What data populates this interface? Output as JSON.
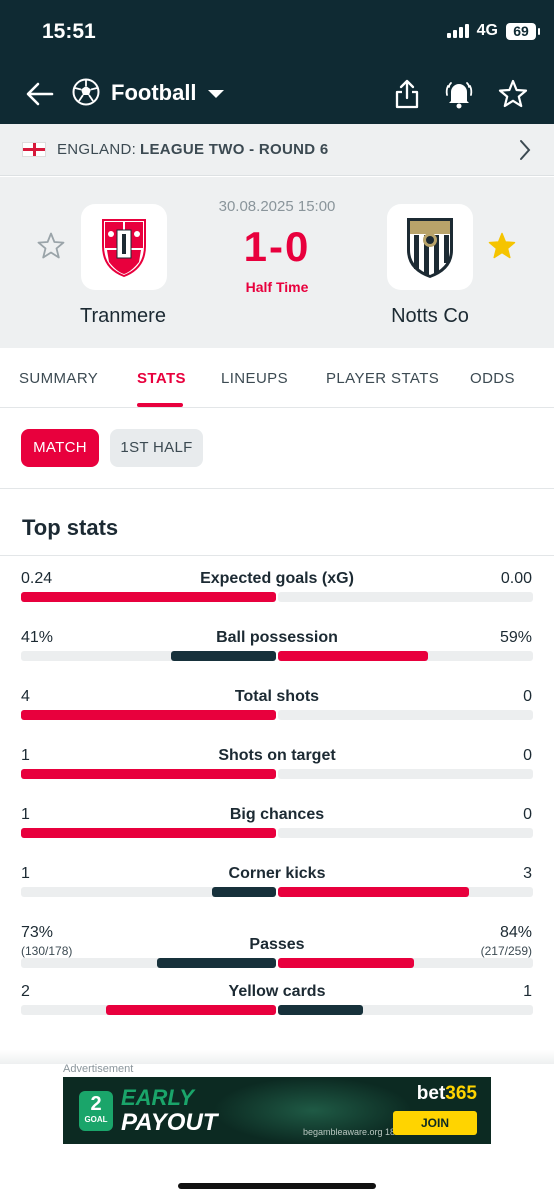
{
  "status_bar": {
    "time": "15:51",
    "network": "4G",
    "battery": "69"
  },
  "nav": {
    "title": "Football"
  },
  "league": {
    "country": "ENGLAND:",
    "name": "LEAGUE TWO - ROUND 6"
  },
  "match": {
    "kickoff": "30.08.2025 15:00",
    "score": "1-0",
    "period": "Half Time",
    "home": {
      "name": "Tranmere",
      "favorite": false,
      "crest_colors": [
        "#e8003d",
        "#1c2a33"
      ]
    },
    "away": {
      "name": "Notts Co",
      "favorite": true,
      "crest_colors": [
        "#1c2a33",
        "#b8a36a"
      ]
    }
  },
  "tabs": [
    {
      "label": "SUMMARY",
      "active": false
    },
    {
      "label": "STATS",
      "active": true
    },
    {
      "label": "LINEUPS",
      "active": false
    },
    {
      "label": "PLAYER STATS",
      "active": false
    },
    {
      "label": "ODDS",
      "active": false
    }
  ],
  "period_filter": {
    "options": [
      "MATCH",
      "1ST HALF"
    ],
    "selected": "MATCH"
  },
  "top_stats": {
    "title": "Top stats",
    "colors": {
      "leader": "#e8003d",
      "trailer": "#17313b",
      "track": "#eceeef"
    },
    "rows": [
      {
        "label": "Expected goals (xG)",
        "home": "0.24",
        "away": "0.00",
        "home_share": 1.0,
        "away_share": 0.0
      },
      {
        "label": "Ball possession",
        "home": "41%",
        "away": "59%",
        "home_share": 0.41,
        "away_share": 0.59
      },
      {
        "label": "Total shots",
        "home": "4",
        "away": "0",
        "home_share": 1.0,
        "away_share": 0.0
      },
      {
        "label": "Shots on target",
        "home": "1",
        "away": "0",
        "home_share": 1.0,
        "away_share": 0.0
      },
      {
        "label": "Big chances",
        "home": "1",
        "away": "0",
        "home_share": 1.0,
        "away_share": 0.0
      },
      {
        "label": "Corner kicks",
        "home": "1",
        "away": "3",
        "home_share": 0.25,
        "away_share": 0.75
      },
      {
        "label": "Passes",
        "home": "73%",
        "away": "84%",
        "home_sub": "(130/178)",
        "away_sub": "(217/259)",
        "home_share": 0.465,
        "away_share": 0.535
      },
      {
        "label": "Yellow cards",
        "home": "2",
        "away": "1",
        "home_share": 0.667,
        "away_share": 0.333
      }
    ]
  },
  "ad": {
    "label": "Advertisement",
    "badge_number": "2",
    "badge_text": "GOAL",
    "line1": "EARLY",
    "line2": "PAYOUT",
    "brand_main": "bet",
    "brand_accent": "365",
    "small_print": "begambleaware.org  18+",
    "cta": "JOIN"
  }
}
